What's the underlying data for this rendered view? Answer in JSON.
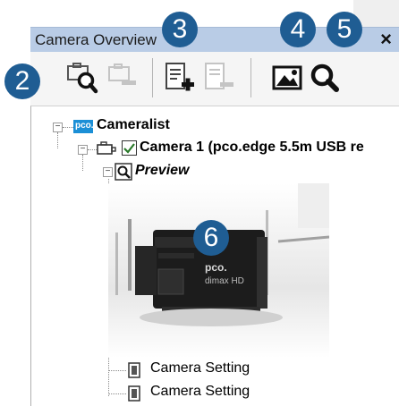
{
  "panel": {
    "title": "Camera Overview",
    "close_label": "×"
  },
  "toolbar": {
    "buttons": [
      {
        "name": "camera-search",
        "icon": "camera-search-icon",
        "enabled": true
      },
      {
        "name": "camera-remove",
        "icon": "camera-remove-icon",
        "enabled": false
      },
      {
        "name": "add-item",
        "icon": "document-add-icon",
        "enabled": true
      },
      {
        "name": "remove-item",
        "icon": "document-remove-icon",
        "enabled": false
      },
      {
        "name": "image",
        "icon": "image-icon",
        "enabled": true
      },
      {
        "name": "zoom",
        "icon": "magnifier-icon",
        "enabled": true
      }
    ]
  },
  "callouts": [
    "2",
    "3",
    "4",
    "5",
    "6"
  ],
  "tree": {
    "root": {
      "logo": "pco.",
      "label": "Cameralist"
    },
    "camera": {
      "label": "Camera 1 (pco.edge 5.5m USB re",
      "checked": true
    },
    "preview": {
      "label": "Preview"
    },
    "preview_image_text": {
      "brand": "pco.",
      "model": "dimax HD"
    },
    "settings": [
      "Camera Setting",
      "Camera Setting"
    ]
  },
  "colors": {
    "titlebar": "#b9cce6",
    "badge": "#1f5d93",
    "logo": "#1b8fd6",
    "check": "#2a7a2a"
  }
}
